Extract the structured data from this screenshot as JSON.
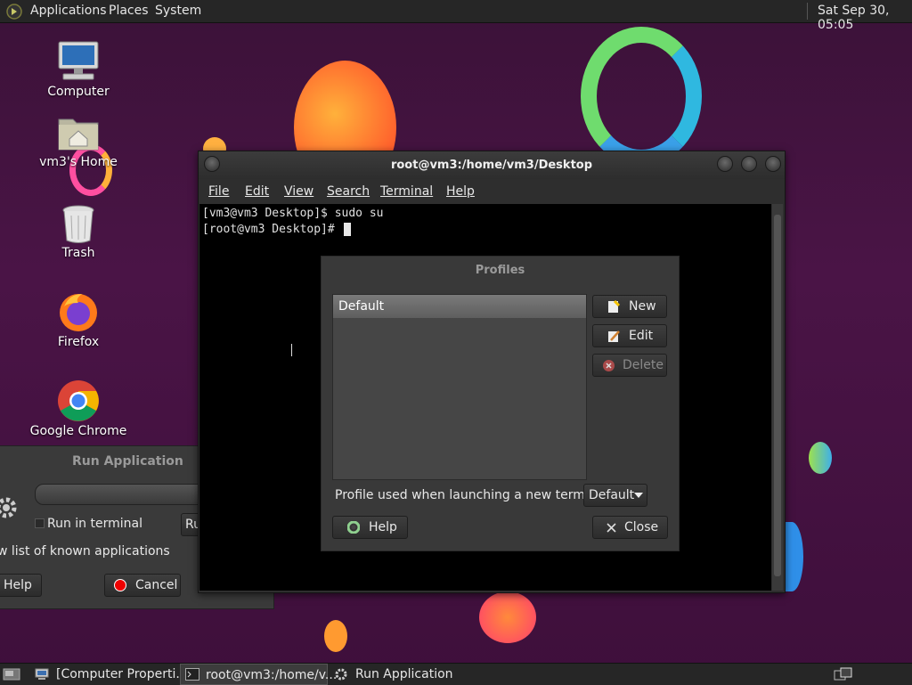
{
  "top_panel": {
    "menus": [
      "Applications",
      "Places",
      "System"
    ],
    "clock": "Sat Sep 30, 05:05"
  },
  "desktop": {
    "icons": [
      {
        "label": "Computer",
        "icon": "computer-icon"
      },
      {
        "label": "vm3's Home",
        "icon": "home-folder-icon"
      },
      {
        "label": "Trash",
        "icon": "trash-icon"
      },
      {
        "label": "Firefox",
        "icon": "firefox-icon"
      },
      {
        "label": "Google Chrome",
        "icon": "chrome-icon"
      }
    ]
  },
  "run_application": {
    "title": "Run Application",
    "run_in_terminal": "Run in terminal",
    "run_button": "Ru",
    "known_apps": "w list of known applications",
    "help_button": "Help",
    "cancel_button": "Cancel"
  },
  "terminal": {
    "title": "root@vm3:/home/vm3/Desktop",
    "menus": [
      "File",
      "Edit",
      "View",
      "Search",
      "Terminal",
      "Help"
    ],
    "lines": [
      "[vm3@vm3 Desktop]$ sudo su",
      "[root@vm3 Desktop]# "
    ]
  },
  "profiles_dialog": {
    "title": "Profiles",
    "profiles": [
      "Default"
    ],
    "new_button": "New",
    "edit_button": "Edit",
    "delete_button": "Delete",
    "launch_label": "Profile used when launching a new terminal:",
    "launch_value": "Default",
    "help_button": "Help",
    "close_button": "Close"
  },
  "taskbar": {
    "tasks": [
      "[Computer Properti...",
      "root@vm3:/home/v...",
      "Run Application"
    ]
  },
  "colors": {
    "desktop_bg": "#3e0f3b",
    "panel_bg": "#262626",
    "dialog_bg": "#393939",
    "terminal_bg": "#000000",
    "selection": "#6a6a6a"
  }
}
